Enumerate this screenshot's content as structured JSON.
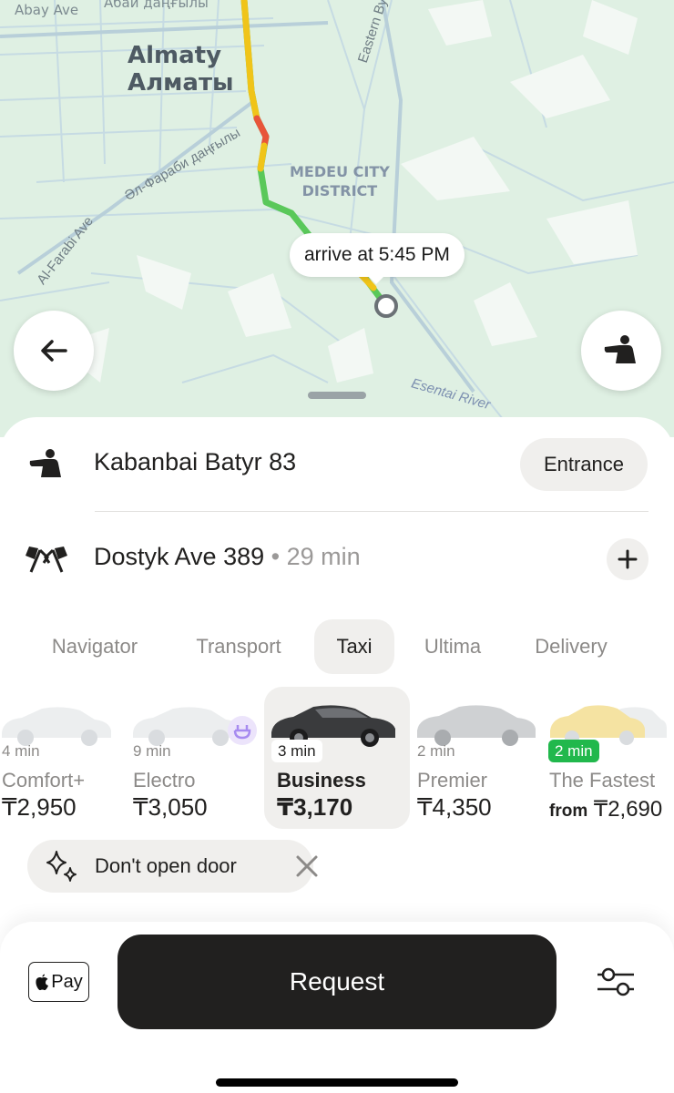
{
  "map": {
    "city_en": "Almaty",
    "city_ru": "Алматы",
    "district_line1": "MEDEU CITY",
    "district_line2": "DISTRICT",
    "streets": {
      "abay_en": "Abay Ave",
      "abay_kz": "Абай даңғылы",
      "eastern_bypass": "Eastern Byp",
      "farabi_kz": "Әл-Фараби даңғылы",
      "farabi_en": "Al-Farabi Ave",
      "river": "Esentai River"
    },
    "arrive_label": "arrive at 5:45 PM"
  },
  "route": {
    "pickup": {
      "address": "Kabanbai Batyr 83",
      "entrance_label": "Entrance"
    },
    "destination": {
      "address": "Dostyk Ave 389",
      "separator": "•",
      "duration": "29 min"
    }
  },
  "tabs": [
    {
      "label": "Navigator"
    },
    {
      "label": "Transport"
    },
    {
      "label": "Taxi",
      "active": true
    },
    {
      "label": "Ultima"
    },
    {
      "label": "Delivery"
    }
  ],
  "tariffs": [
    {
      "eta": "4 min",
      "name": "Comfort+",
      "currency": "₸",
      "price": "2,950"
    },
    {
      "eta": "9 min",
      "name": "Electro",
      "currency": "₸",
      "price": "3,050"
    },
    {
      "eta": "3 min",
      "name": "Business",
      "currency": "₸",
      "price": "3,170",
      "selected": true
    },
    {
      "eta": "2 min",
      "name": "Premier",
      "currency": "₸",
      "price": "4,350"
    },
    {
      "eta": "2 min",
      "name": "The Fastest",
      "prefix": "from",
      "currency": "₸",
      "price": "2,690"
    }
  ],
  "option_chip": {
    "label": "Don't open door"
  },
  "bottom": {
    "pay_label": "Pay",
    "request_label": "Request"
  },
  "colors": {
    "accent_dark": "#21201f",
    "chip_bg": "#f0efed",
    "eta_green": "#21b84c",
    "map_bg": "#dff0e3",
    "route_green": "#5ac85a",
    "route_yellow": "#f0c419",
    "route_red": "#e8553a"
  },
  "icons": {
    "back": "arrow-left-icon",
    "pickup": "person-pointing-icon",
    "destination": "checkered-flags-icon",
    "add_stop": "plus-icon",
    "sparkles": "sparkles-icon",
    "remove": "close-icon",
    "apple": "apple-logo-icon",
    "settings": "sliders-icon"
  }
}
